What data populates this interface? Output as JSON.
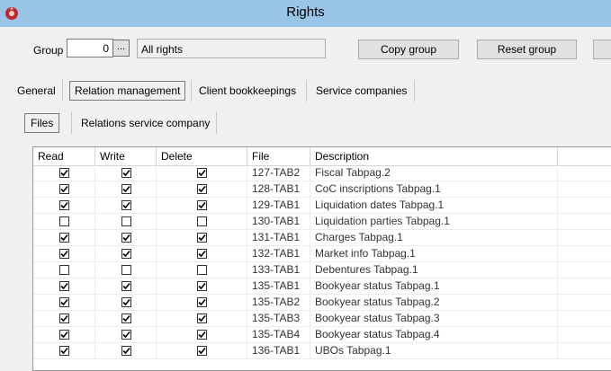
{
  "window": {
    "title": "Rights"
  },
  "group": {
    "label": "Group",
    "value": "0",
    "lookup_label": "...",
    "name": "All rights"
  },
  "buttons": {
    "copy_group": "Copy group",
    "reset_group": "Reset group"
  },
  "main_tabs": [
    {
      "label": "General",
      "selected": false
    },
    {
      "label": "Relation management",
      "selected": true
    },
    {
      "label": "Client bookkeepings",
      "selected": false
    },
    {
      "label": "Service companies",
      "selected": false
    }
  ],
  "sub_tabs": [
    {
      "label": "Files",
      "selected": true
    },
    {
      "label": "Relations service company",
      "selected": false
    }
  ],
  "table": {
    "columns": [
      "Read",
      "Write",
      "Delete",
      "File",
      "Description"
    ],
    "rows": [
      {
        "read": true,
        "write": true,
        "delete": true,
        "file": "127-TAB2",
        "description": "Fiscal Tabpag.2"
      },
      {
        "read": true,
        "write": true,
        "delete": true,
        "file": "128-TAB1",
        "description": "CoC inscriptions Tabpag.1"
      },
      {
        "read": true,
        "write": true,
        "delete": true,
        "file": "129-TAB1",
        "description": "Liquidation dates Tabpag.1"
      },
      {
        "read": false,
        "write": false,
        "delete": false,
        "file": "130-TAB1",
        "description": "Liquidation parties Tabpag.1"
      },
      {
        "read": true,
        "write": true,
        "delete": true,
        "file": "131-TAB1",
        "description": "Charges Tabpag.1"
      },
      {
        "read": true,
        "write": true,
        "delete": true,
        "file": "132-TAB1",
        "description": "Market info Tabpag.1"
      },
      {
        "read": false,
        "write": false,
        "delete": false,
        "file": "133-TAB1",
        "description": "Debentures Tabpag.1"
      },
      {
        "read": true,
        "write": true,
        "delete": true,
        "file": "135-TAB1",
        "description": "Bookyear status Tabpag.1"
      },
      {
        "read": true,
        "write": true,
        "delete": true,
        "file": "135-TAB2",
        "description": "Bookyear status Tabpag.2"
      },
      {
        "read": true,
        "write": true,
        "delete": true,
        "file": "135-TAB3",
        "description": "Bookyear status Tabpag.3"
      },
      {
        "read": true,
        "write": true,
        "delete": true,
        "file": "135-TAB4",
        "description": "Bookyear status Tabpag.4"
      },
      {
        "read": true,
        "write": true,
        "delete": true,
        "file": "136-TAB1",
        "description": "UBOs Tabpag.1"
      }
    ]
  },
  "colors": {
    "titlebar": "#99c6e6",
    "window_bg": "#f0f0f0",
    "app_icon": "#c0272d"
  }
}
